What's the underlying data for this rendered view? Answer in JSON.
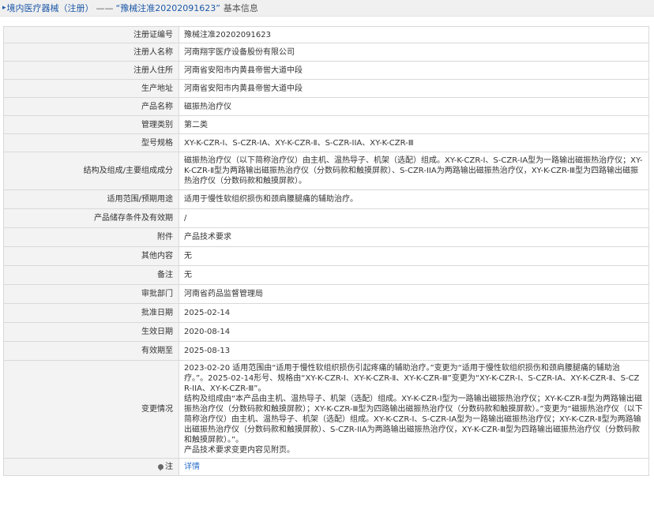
{
  "header": {
    "arrow_icon": "caret-right-icon",
    "category": "境内医疗器械（注册）",
    "separator": "——",
    "record_title": "“豫械注准20202091623”",
    "suffix": "基本信息"
  },
  "rows": [
    {
      "label": "注册证编号",
      "value": "豫械注准20202091623"
    },
    {
      "label": "注册人名称",
      "value": "河南翔宇医疗设备股份有限公司"
    },
    {
      "label": "注册人住所",
      "value": "河南省安阳市内黄县帝喾大道中段"
    },
    {
      "label": "生产地址",
      "value": "河南省安阳市内黄县帝喾大道中段"
    },
    {
      "label": "产品名称",
      "value": "磁振热治疗仪"
    },
    {
      "label": "管理类别",
      "value": "第二类"
    },
    {
      "label": "型号规格",
      "value": "XY-K-CZR-Ⅰ、S-CZR-IA、XY-K-CZR-Ⅱ、S-CZR-IIA、XY-K-CZR-Ⅲ"
    },
    {
      "label": "结构及组成/主要组成成分",
      "value": "磁振热治疗仪（以下简称治疗仪）由主机、温热导子、机架（选配）组成。XY-K-CZR-Ⅰ、S-CZR-IA型为一路输出磁振热治疗仪；XY-K-CZR-Ⅱ型为两路输出磁振热治疗仪（分数码款和触摸屏款）、S-CZR-IIA为两路输出磁振热治疗仪，XY-K-CZR-Ⅲ型为四路输出磁振热治疗仪（分数码款和触摸屏款）。"
    },
    {
      "label": "适用范围/预期用途",
      "value": "适用于慢性软组织损伤和颈肩腰腿痛的辅助治疗。"
    },
    {
      "label": "产品储存条件及有效期",
      "value": "/"
    },
    {
      "label": "附件",
      "value": "产品技术要求"
    },
    {
      "label": "其他内容",
      "value": "无"
    },
    {
      "label": "备注",
      "value": "无"
    },
    {
      "label": "审批部门",
      "value": "河南省药品监督管理局"
    },
    {
      "label": "批准日期",
      "value": "2025-02-14"
    },
    {
      "label": "生效日期",
      "value": "2020-08-14"
    },
    {
      "label": "有效期至",
      "value": "2025-08-13"
    }
  ],
  "change": {
    "label": "变更情况",
    "lines": [
      "2023-02-20 适用范围由“适用于慢性软组织损伤引起疼痛的辅助治疗。”变更为“适用于慢性软组织损伤和颈肩腰腿痛的辅助治疗。”。2025-02-14形号、规格由“XY-K-CZR-Ⅰ、XY-K-CZR-Ⅱ、XY-K-CZR-Ⅲ”变更为“XY-K-CZR-Ⅰ、S-CZR-IA、XY-K-CZR-Ⅱ、S-CZR-IIA、XY-K-CZR-Ⅲ”。",
      "结构及组成由“本产品由主机、温热导子、机架（选配）组成。XY-K-CZR-Ⅰ型为一路输出磁振热治疗仪；XY-K-CZR-Ⅱ型为两路输出磁振热治疗仪（分数码款和触摸屏款）；XY-K-CZR-Ⅲ型为四路输出磁振热治疗仪（分数码款和触摸屏款）。”变更为“磁振热治疗仪（以下简称治疗仪）由主机、温热导子、机架（选配）组成。XY-K-CZR-Ⅰ、S-CZR-IA型为一路输出磁振热治疗仪；XY-K-CZR-Ⅱ型为两路输出磁振热治疗仪（分数码款和触摸屏款）、S-CZR-IIA为两路输出磁振热治疗仪，XY-K-CZR-Ⅲ型为四路输出磁振热治疗仪（分数码款和触摸屏款）。”。",
      "产品技术要求变更内容见附页。"
    ]
  },
  "note_row": {
    "icon": "location-pin-icon",
    "label": "注",
    "link": "详情"
  },
  "colors": {
    "header_link": "#1d58a8",
    "detail_link": "#2a6fc9",
    "label_bg": "#f3f3f3",
    "border": "#d9d9d9"
  }
}
